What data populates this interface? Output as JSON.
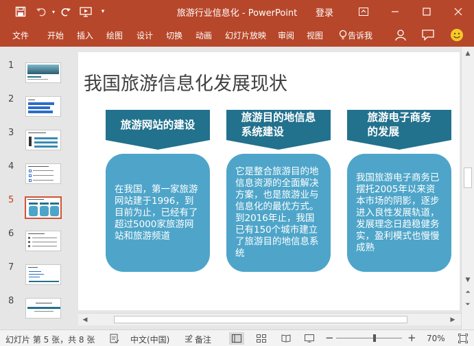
{
  "titlebar": {
    "doc_title": "旅游行业信息化",
    "separator": " - ",
    "app_name": "PowerPoint",
    "login_label": "登录",
    "window_buttons": [
      "ribbon-display-options",
      "minimize",
      "maximize",
      "close"
    ],
    "quick_access": [
      "save-icon",
      "undo-icon",
      "redo-icon",
      "start-from-beginning-icon",
      "customize-icon"
    ]
  },
  "ribbon": {
    "tabs": [
      "文件",
      "开始",
      "插入",
      "绘图",
      "设计",
      "切换",
      "动画",
      "幻灯片放映",
      "审阅",
      "视图"
    ],
    "tell_me": "告诉我",
    "icons": [
      "lightbulb-icon",
      "account-icon",
      "comments-icon",
      "smiley-icon"
    ]
  },
  "thumbnails": {
    "numbers": [
      "1",
      "2",
      "3",
      "4",
      "5",
      "6",
      "7",
      "8"
    ],
    "active_index": 5
  },
  "slide": {
    "title": "我国旅游信息化发展现状",
    "columns": [
      {
        "header_line1": "旅游网站的建设",
        "header_line2": "",
        "body": "在我国，第一家旅游网站建于1996，到目前为止，已经有了超过5000家旅游网站和旅游频道"
      },
      {
        "header_line1": "旅游目的地信息",
        "header_line2": "系统建设",
        "body": "它是整合旅游目的地信息资源的全面解决方案，也是旅游业与信息化的最优方式。到2016年止，我国已有150个城市建立了旅游目的地信息系统"
      },
      {
        "header_line1": "旅游电子商务",
        "header_line2": "的发展",
        "body": "我国旅游电子商务已摆托2005年以来资本市场的阴影，逐步进入良性发展轨道，发展理念日趋稳健务实，盈利模式也慢慢成熟"
      }
    ],
    "colors": {
      "header": "#22718d",
      "body": "#4ea5c9",
      "title_text": "#404040"
    }
  },
  "statusbar": {
    "slide_info": "幻灯片 第 5 张，共 8 张",
    "language": "中文(中国)",
    "notes": "备注",
    "zoom_out": "−",
    "zoom_in": "+",
    "zoom_level": "70%",
    "zoom_fraction": 0.58
  },
  "theme": {
    "accent": "#b7472a"
  }
}
